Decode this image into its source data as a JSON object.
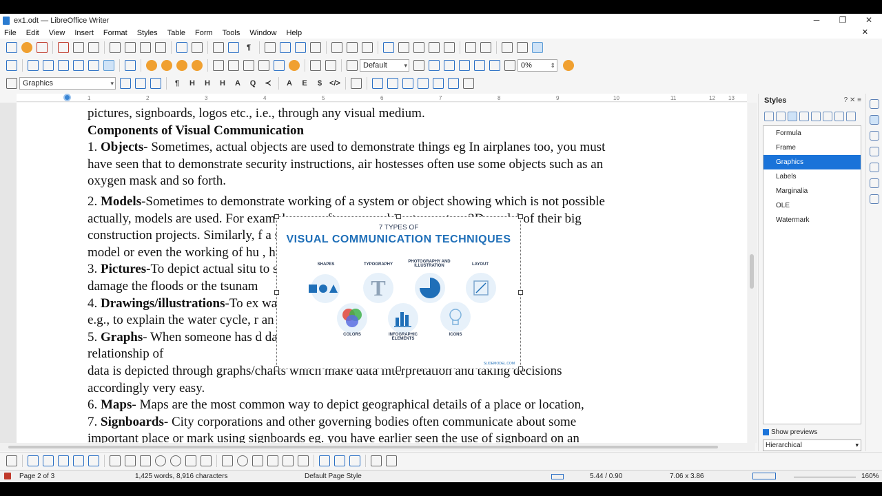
{
  "window": {
    "title": "ex1.odt — LibreOffice Writer",
    "minimize": "─",
    "maximize": "❐",
    "close": "✕"
  },
  "menu": [
    "File",
    "Edit",
    "View",
    "Insert",
    "Format",
    "Styles",
    "Table",
    "Form",
    "Tools",
    "Window",
    "Help"
  ],
  "menu_close": "✕",
  "toolbar3": {
    "frame_style": "Default",
    "transparency": "0%"
  },
  "toolbar4": {
    "paragraph_style": "Graphics"
  },
  "ruler_numbers": [
    "1",
    "2",
    "3",
    "4",
    "5",
    "6",
    "7",
    "8",
    "9",
    "10",
    "11",
    "12",
    "13"
  ],
  "document": {
    "lines": [
      "pictures, signboards, logos etc., i.e., through any visual medium.",
      "Components of Visual Communication",
      "1. |Objects|- Sometimes, actual objects are used to demonstrate things eg In airplanes too, you must",
      "have seen that to demonstrate security instructions, air hostesses often use some objects such as an",
      "oxygen mask and so forth.",
      "",
      "2. |Models|-Sometimes to demonstrate working of a system or object showing which is not possible",
      "actually, models are used. For example, you often see architects create a 3D model of their big",
      "construction projects. Similarly,                                                           f  a solar system through a",
      "model or even the working of hu                                                        , human skeleton etc.",
      "3. |Pictures|-To depict actual situ                                                       to show how much",
      "damage the floods or the tsunam",
      "4. |Drawings/illustrations|-To ex                                                       way is to use illustration",
      "e.g., to explain the water cycle,                                                         r an illustration.",
      "5. |Graphs|- When someone has                                                          d data, then the",
      "relationship of",
      "data is depicted through graphs/charts which make data interpretation and taking decisions",
      "accordingly very easy.",
      "6. |Maps|- Maps are the most common way to depict geographical details of a place or location,",
      "7. |Signboards|- City corporations and other governing bodies often communicate about some",
      "important place or mark using signboards eg. you have earlier seen the use of signboard on an"
    ]
  },
  "image": {
    "heading": "7 TYPES OF",
    "title": "VISUAL COMMUNICATION TECHNIQUES",
    "captions": [
      "SHAPES",
      "TYPOGRAPHY",
      "PHOTOGRAPHY AND ILLUSTRATION",
      "LAYOUT",
      "COLORS",
      "INFOGRAPHIC ELEMENTS",
      "ICONS"
    ],
    "footer": "SLIDEMODEL.COM",
    "colors": {
      "blue": "#1f6fb8",
      "light": "#e7f1fa"
    }
  },
  "sidebar": {
    "title": "Styles",
    "items": [
      "Formula",
      "Frame",
      "Graphics",
      "Labels",
      "Marginalia",
      "OLE",
      "Watermark"
    ],
    "selected": "Graphics",
    "show_previews": "Show previews",
    "filter": "Hierarchical"
  },
  "status": {
    "page": "Page 2 of 3",
    "words": "1,425 words, 8,916 characters",
    "page_style": "Default Page Style",
    "position": "5.44 / 0.90",
    "size": "7.06 x 3.86",
    "zoom": "160%"
  },
  "colors": {
    "selection": "#1a73d9",
    "accent": "#2a6fc4"
  }
}
